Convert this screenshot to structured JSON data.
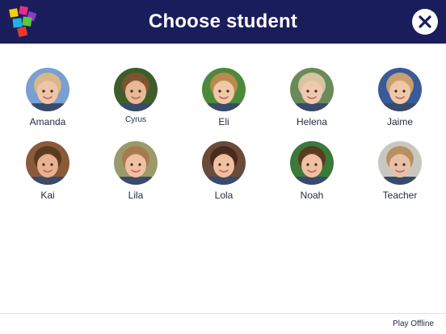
{
  "header": {
    "title": "Choose student",
    "logo_icon": "app-logo-icon",
    "close_icon": "close-icon",
    "background": "#1a1d5c"
  },
  "students": [
    {
      "name": "Amanda",
      "bg": "#7a9fd0",
      "skin": "#f0c4a8",
      "hair": "#d8b88a"
    },
    {
      "name": "Cyrus",
      "bg": "#3d5e2a",
      "skin": "#e8b898",
      "hair": "#7a5530"
    },
    {
      "name": "Eli",
      "bg": "#4c8a3a",
      "skin": "#f0c8a8",
      "hair": "#b88a50"
    },
    {
      "name": "Helena",
      "bg": "#6a8a5a",
      "skin": "#f0c8b0",
      "hair": "#d8c4a0"
    },
    {
      "name": "Jaime",
      "bg": "#3a5a9a",
      "skin": "#f0c8a8",
      "hair": "#c8a070"
    },
    {
      "name": "Kai",
      "bg": "#8a5a3a",
      "skin": "#e8b090",
      "hair": "#5a3a20"
    },
    {
      "name": "Lila",
      "bg": "#9a9a6a",
      "skin": "#f0c0a0",
      "hair": "#a87a50"
    },
    {
      "name": "Lola",
      "bg": "#6a4a3a",
      "skin": "#f0c0a0",
      "hair": "#4a2a1a"
    },
    {
      "name": "Noah",
      "bg": "#3a7a3a",
      "skin": "#f0c0a0",
      "hair": "#5a3a20"
    },
    {
      "name": "Teacher",
      "bg": "#c8c8c0",
      "skin": "#e8c0a8",
      "hair": "#b89060"
    }
  ],
  "footer": {
    "play_offline": "Play Offline"
  }
}
